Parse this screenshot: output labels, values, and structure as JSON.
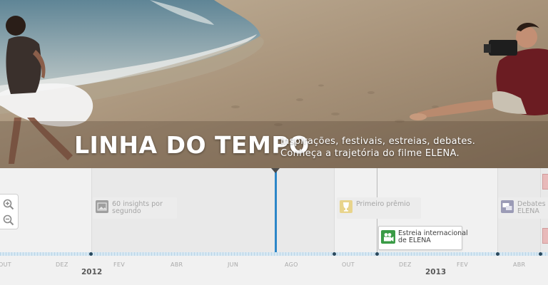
{
  "hero": {
    "title": "LINHA DO TEMPO",
    "subtitle_line1": "Inspirações, festivais, estreias, debates.",
    "subtitle_line2": "Conheça a trajetória do filme ELENA."
  },
  "timeline": {
    "events": [
      {
        "label": "60 insights por segundo",
        "state": "inactive"
      },
      {
        "label": "Primeiro prêmio",
        "state": "inactive"
      },
      {
        "label": "Debates a ELENA",
        "state": "inactive"
      },
      {
        "label": "Estreia internacional de ELENA",
        "state": "active"
      }
    ],
    "months": [
      "OUT",
      "DEZ",
      "FEV",
      "ABR",
      "JUN",
      "AGO",
      "OUT",
      "DEZ",
      "FEV",
      "ABR"
    ],
    "years": [
      "2012",
      "2013"
    ],
    "colors": {
      "cursor": "#2b86c8",
      "axis": "#b9d4e6",
      "active_icon": "#3a9b46"
    }
  },
  "icons": {
    "zoom_in": "zoom-in-icon",
    "zoom_out": "zoom-out-icon",
    "event_insights": "image-icon",
    "event_award": "trophy-icon",
    "event_debates": "chat-icon",
    "event_premiere": "video-camera-icon"
  }
}
